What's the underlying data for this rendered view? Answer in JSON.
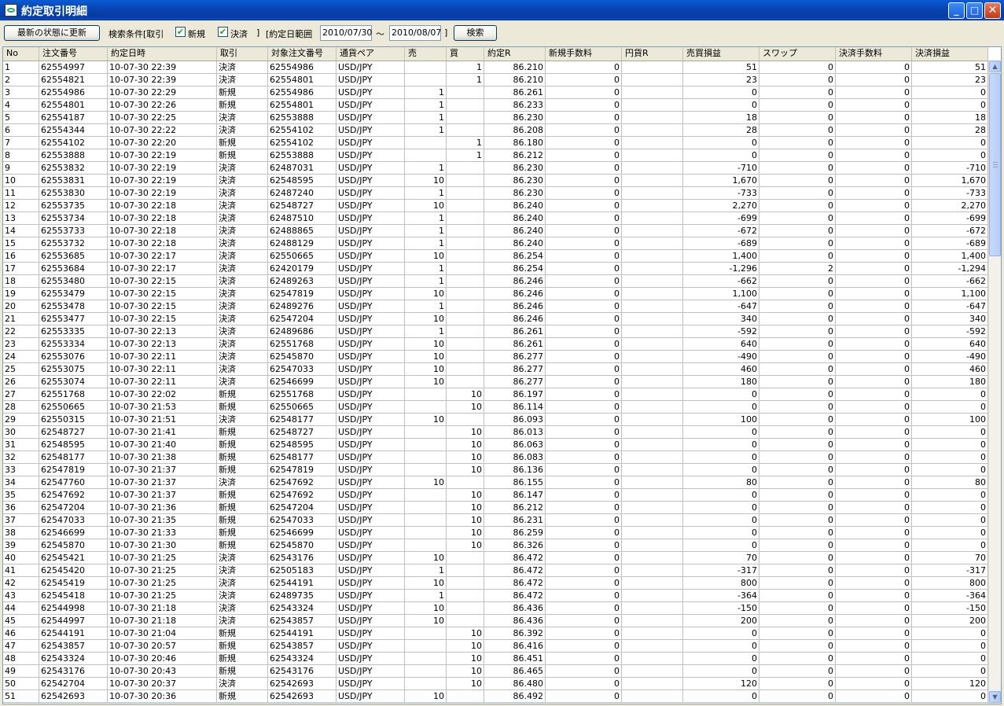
{
  "window": {
    "title": "約定取引明細",
    "minimize": "_",
    "maximize": "□",
    "close": "✕"
  },
  "toolbar": {
    "refresh_label": "最新の状態に更新",
    "search_condition_label": "検索条件[取引",
    "new_label": "新規",
    "new_checked": true,
    "settle_label": "決済",
    "settle_checked": true,
    "close_bracket": "]",
    "date_range_label": "[約定日範囲",
    "date_from": "2010/07/30",
    "tilde": "～",
    "date_to": "2010/08/07",
    "date_close": "]",
    "search_label": "検索"
  },
  "table": {
    "headers": [
      "No",
      "注文番号",
      "約定日時",
      "取引",
      "対象注文番号",
      "通貨ペア",
      "売",
      "買",
      "約定R",
      "新規手数料",
      "円貨R",
      "売買損益",
      "スワップ",
      "決済手数料",
      "決済損益"
    ],
    "rows": [
      [
        "1",
        "62554997",
        "10-07-30 22:39",
        "決済",
        "62554986",
        "USD/JPY",
        "",
        "1",
        "86.210",
        "0",
        "",
        "51",
        "0",
        "0",
        "51"
      ],
      [
        "2",
        "62554821",
        "10-07-30 22:39",
        "決済",
        "62554801",
        "USD/JPY",
        "",
        "1",
        "86.210",
        "0",
        "",
        "23",
        "0",
        "0",
        "23"
      ],
      [
        "3",
        "62554986",
        "10-07-30 22:29",
        "新規",
        "62554986",
        "USD/JPY",
        "1",
        "",
        "86.261",
        "0",
        "",
        "0",
        "0",
        "0",
        "0"
      ],
      [
        "4",
        "62554801",
        "10-07-30 22:26",
        "新規",
        "62554801",
        "USD/JPY",
        "1",
        "",
        "86.233",
        "0",
        "",
        "0",
        "0",
        "0",
        "0"
      ],
      [
        "5",
        "62554187",
        "10-07-30 22:25",
        "決済",
        "62553888",
        "USD/JPY",
        "1",
        "",
        "86.230",
        "0",
        "",
        "18",
        "0",
        "0",
        "18"
      ],
      [
        "6",
        "62554344",
        "10-07-30 22:22",
        "決済",
        "62554102",
        "USD/JPY",
        "1",
        "",
        "86.208",
        "0",
        "",
        "28",
        "0",
        "0",
        "28"
      ],
      [
        "7",
        "62554102",
        "10-07-30 22:20",
        "新規",
        "62554102",
        "USD/JPY",
        "",
        "1",
        "86.180",
        "0",
        "",
        "0",
        "0",
        "0",
        "0"
      ],
      [
        "8",
        "62553888",
        "10-07-30 22:19",
        "新規",
        "62553888",
        "USD/JPY",
        "",
        "1",
        "86.212",
        "0",
        "",
        "0",
        "0",
        "0",
        "0"
      ],
      [
        "9",
        "62553832",
        "10-07-30 22:19",
        "決済",
        "62487031",
        "USD/JPY",
        "1",
        "",
        "86.230",
        "0",
        "",
        "-710",
        "0",
        "0",
        "-710"
      ],
      [
        "10",
        "62553831",
        "10-07-30 22:19",
        "決済",
        "62548595",
        "USD/JPY",
        "10",
        "",
        "86.230",
        "0",
        "",
        "1,670",
        "0",
        "0",
        "1,670"
      ],
      [
        "11",
        "62553830",
        "10-07-30 22:19",
        "決済",
        "62487240",
        "USD/JPY",
        "1",
        "",
        "86.230",
        "0",
        "",
        "-733",
        "0",
        "0",
        "-733"
      ],
      [
        "12",
        "62553735",
        "10-07-30 22:18",
        "決済",
        "62548727",
        "USD/JPY",
        "10",
        "",
        "86.240",
        "0",
        "",
        "2,270",
        "0",
        "0",
        "2,270"
      ],
      [
        "13",
        "62553734",
        "10-07-30 22:18",
        "決済",
        "62487510",
        "USD/JPY",
        "1",
        "",
        "86.240",
        "0",
        "",
        "-699",
        "0",
        "0",
        "-699"
      ],
      [
        "14",
        "62553733",
        "10-07-30 22:18",
        "決済",
        "62488865",
        "USD/JPY",
        "1",
        "",
        "86.240",
        "0",
        "",
        "-672",
        "0",
        "0",
        "-672"
      ],
      [
        "15",
        "62553732",
        "10-07-30 22:18",
        "決済",
        "62488129",
        "USD/JPY",
        "1",
        "",
        "86.240",
        "0",
        "",
        "-689",
        "0",
        "0",
        "-689"
      ],
      [
        "16",
        "62553685",
        "10-07-30 22:17",
        "決済",
        "62550665",
        "USD/JPY",
        "10",
        "",
        "86.254",
        "0",
        "",
        "1,400",
        "0",
        "0",
        "1,400"
      ],
      [
        "17",
        "62553684",
        "10-07-30 22:17",
        "決済",
        "62420179",
        "USD/JPY",
        "1",
        "",
        "86.254",
        "0",
        "",
        "-1,296",
        "2",
        "0",
        "-1,294"
      ],
      [
        "18",
        "62553480",
        "10-07-30 22:15",
        "決済",
        "62489263",
        "USD/JPY",
        "1",
        "",
        "86.246",
        "0",
        "",
        "-662",
        "0",
        "0",
        "-662"
      ],
      [
        "19",
        "62553479",
        "10-07-30 22:15",
        "決済",
        "62547819",
        "USD/JPY",
        "10",
        "",
        "86.246",
        "0",
        "",
        "1,100",
        "0",
        "0",
        "1,100"
      ],
      [
        "20",
        "62553478",
        "10-07-30 22:15",
        "決済",
        "62489276",
        "USD/JPY",
        "1",
        "",
        "86.246",
        "0",
        "",
        "-647",
        "0",
        "0",
        "-647"
      ],
      [
        "21",
        "62553477",
        "10-07-30 22:15",
        "決済",
        "62547204",
        "USD/JPY",
        "10",
        "",
        "86.246",
        "0",
        "",
        "340",
        "0",
        "0",
        "340"
      ],
      [
        "22",
        "62553335",
        "10-07-30 22:13",
        "決済",
        "62489686",
        "USD/JPY",
        "1",
        "",
        "86.261",
        "0",
        "",
        "-592",
        "0",
        "0",
        "-592"
      ],
      [
        "23",
        "62553334",
        "10-07-30 22:13",
        "決済",
        "62551768",
        "USD/JPY",
        "10",
        "",
        "86.261",
        "0",
        "",
        "640",
        "0",
        "0",
        "640"
      ],
      [
        "24",
        "62553076",
        "10-07-30 22:11",
        "決済",
        "62545870",
        "USD/JPY",
        "10",
        "",
        "86.277",
        "0",
        "",
        "-490",
        "0",
        "0",
        "-490"
      ],
      [
        "25",
        "62553075",
        "10-07-30 22:11",
        "決済",
        "62547033",
        "USD/JPY",
        "10",
        "",
        "86.277",
        "0",
        "",
        "460",
        "0",
        "0",
        "460"
      ],
      [
        "26",
        "62553074",
        "10-07-30 22:11",
        "決済",
        "62546699",
        "USD/JPY",
        "10",
        "",
        "86.277",
        "0",
        "",
        "180",
        "0",
        "0",
        "180"
      ],
      [
        "27",
        "62551768",
        "10-07-30 22:02",
        "新規",
        "62551768",
        "USD/JPY",
        "",
        "10",
        "86.197",
        "0",
        "",
        "0",
        "0",
        "0",
        "0"
      ],
      [
        "28",
        "62550665",
        "10-07-30 21:53",
        "新規",
        "62550665",
        "USD/JPY",
        "",
        "10",
        "86.114",
        "0",
        "",
        "0",
        "0",
        "0",
        "0"
      ],
      [
        "29",
        "62550315",
        "10-07-30 21:51",
        "決済",
        "62548177",
        "USD/JPY",
        "10",
        "",
        "86.093",
        "0",
        "",
        "100",
        "0",
        "0",
        "100"
      ],
      [
        "30",
        "62548727",
        "10-07-30 21:41",
        "新規",
        "62548727",
        "USD/JPY",
        "",
        "10",
        "86.013",
        "0",
        "",
        "0",
        "0",
        "0",
        "0"
      ],
      [
        "31",
        "62548595",
        "10-07-30 21:40",
        "新規",
        "62548595",
        "USD/JPY",
        "",
        "10",
        "86.063",
        "0",
        "",
        "0",
        "0",
        "0",
        "0"
      ],
      [
        "32",
        "62548177",
        "10-07-30 21:38",
        "新規",
        "62548177",
        "USD/JPY",
        "",
        "10",
        "86.083",
        "0",
        "",
        "0",
        "0",
        "0",
        "0"
      ],
      [
        "33",
        "62547819",
        "10-07-30 21:37",
        "新規",
        "62547819",
        "USD/JPY",
        "",
        "10",
        "86.136",
        "0",
        "",
        "0",
        "0",
        "0",
        "0"
      ],
      [
        "34",
        "62547760",
        "10-07-30 21:37",
        "決済",
        "62547692",
        "USD/JPY",
        "10",
        "",
        "86.155",
        "0",
        "",
        "80",
        "0",
        "0",
        "80"
      ],
      [
        "35",
        "62547692",
        "10-07-30 21:37",
        "新規",
        "62547692",
        "USD/JPY",
        "",
        "10",
        "86.147",
        "0",
        "",
        "0",
        "0",
        "0",
        "0"
      ],
      [
        "36",
        "62547204",
        "10-07-30 21:36",
        "新規",
        "62547204",
        "USD/JPY",
        "",
        "10",
        "86.212",
        "0",
        "",
        "0",
        "0",
        "0",
        "0"
      ],
      [
        "37",
        "62547033",
        "10-07-30 21:35",
        "新規",
        "62547033",
        "USD/JPY",
        "",
        "10",
        "86.231",
        "0",
        "",
        "0",
        "0",
        "0",
        "0"
      ],
      [
        "38",
        "62546699",
        "10-07-30 21:33",
        "新規",
        "62546699",
        "USD/JPY",
        "",
        "10",
        "86.259",
        "0",
        "",
        "0",
        "0",
        "0",
        "0"
      ],
      [
        "39",
        "62545870",
        "10-07-30 21:30",
        "新規",
        "62545870",
        "USD/JPY",
        "",
        "10",
        "86.326",
        "0",
        "",
        "0",
        "0",
        "0",
        "0"
      ],
      [
        "40",
        "62545421",
        "10-07-30 21:25",
        "決済",
        "62543176",
        "USD/JPY",
        "10",
        "",
        "86.472",
        "0",
        "",
        "70",
        "0",
        "0",
        "70"
      ],
      [
        "41",
        "62545420",
        "10-07-30 21:25",
        "決済",
        "62505183",
        "USD/JPY",
        "1",
        "",
        "86.472",
        "0",
        "",
        "-317",
        "0",
        "0",
        "-317"
      ],
      [
        "42",
        "62545419",
        "10-07-30 21:25",
        "決済",
        "62544191",
        "USD/JPY",
        "10",
        "",
        "86.472",
        "0",
        "",
        "800",
        "0",
        "0",
        "800"
      ],
      [
        "43",
        "62545418",
        "10-07-30 21:25",
        "決済",
        "62489735",
        "USD/JPY",
        "1",
        "",
        "86.472",
        "0",
        "",
        "-364",
        "0",
        "0",
        "-364"
      ],
      [
        "44",
        "62544998",
        "10-07-30 21:18",
        "決済",
        "62543324",
        "USD/JPY",
        "10",
        "",
        "86.436",
        "0",
        "",
        "-150",
        "0",
        "0",
        "-150"
      ],
      [
        "45",
        "62544997",
        "10-07-30 21:18",
        "決済",
        "62543857",
        "USD/JPY",
        "10",
        "",
        "86.436",
        "0",
        "",
        "200",
        "0",
        "0",
        "200"
      ],
      [
        "46",
        "62544191",
        "10-07-30 21:04",
        "新規",
        "62544191",
        "USD/JPY",
        "",
        "10",
        "86.392",
        "0",
        "",
        "0",
        "0",
        "0",
        "0"
      ],
      [
        "47",
        "62543857",
        "10-07-30 20:57",
        "新規",
        "62543857",
        "USD/JPY",
        "",
        "10",
        "86.416",
        "0",
        "",
        "0",
        "0",
        "0",
        "0"
      ],
      [
        "48",
        "62543324",
        "10-07-30 20:46",
        "新規",
        "62543324",
        "USD/JPY",
        "",
        "10",
        "86.451",
        "0",
        "",
        "0",
        "0",
        "0",
        "0"
      ],
      [
        "49",
        "62543176",
        "10-07-30 20:43",
        "新規",
        "62543176",
        "USD/JPY",
        "",
        "10",
        "86.465",
        "0",
        "",
        "0",
        "0",
        "0",
        "0"
      ],
      [
        "50",
        "62542704",
        "10-07-30 20:37",
        "決済",
        "62542693",
        "USD/JPY",
        "",
        "10",
        "86.480",
        "0",
        "",
        "120",
        "0",
        "0",
        "120"
      ],
      [
        "51",
        "62542693",
        "10-07-30 20:36",
        "新規",
        "62542693",
        "USD/JPY",
        "10",
        "",
        "86.492",
        "0",
        "",
        "0",
        "0",
        "0",
        "0"
      ]
    ]
  },
  "scrollbar": {
    "up": "▲",
    "down": "▼"
  }
}
